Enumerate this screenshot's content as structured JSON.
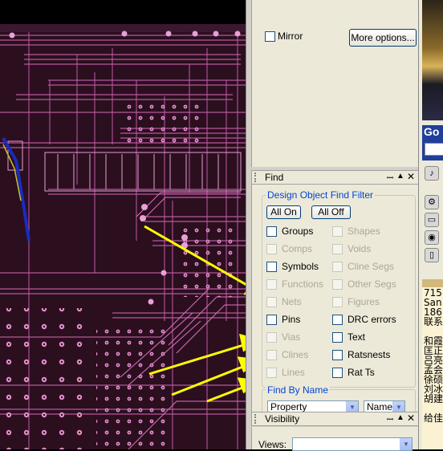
{
  "mirror": {
    "label": "Mirror",
    "checked": false
  },
  "more_options_label": "More options...",
  "find_panel": {
    "title": "Find",
    "filter_title": "Design Object Find Filter",
    "all_on": "All On",
    "all_off": "All Off",
    "left_items": [
      {
        "label": "Groups",
        "enabled": true
      },
      {
        "label": "Comps",
        "enabled": false
      },
      {
        "label": "Symbols",
        "enabled": true
      },
      {
        "label": "Functions",
        "enabled": false
      },
      {
        "label": "Nets",
        "enabled": false
      },
      {
        "label": "Pins",
        "enabled": true
      },
      {
        "label": "Vias",
        "enabled": false
      },
      {
        "label": "Clines",
        "enabled": false
      },
      {
        "label": "Lines",
        "enabled": false
      }
    ],
    "right_items": [
      {
        "label": "Shapes",
        "enabled": false
      },
      {
        "label": "Voids",
        "enabled": false
      },
      {
        "label": "Cline Segs",
        "enabled": false
      },
      {
        "label": "Other Segs",
        "enabled": false
      },
      {
        "label": "Figures",
        "enabled": false
      },
      {
        "label": "DRC errors",
        "enabled": true
      },
      {
        "label": "Text",
        "enabled": true
      },
      {
        "label": "Ratsnests",
        "enabled": true
      },
      {
        "label": "Rat Ts",
        "enabled": true
      }
    ],
    "find_by_name_title": "Find By Name",
    "property_value": "Property",
    "name_value": "Name"
  },
  "visibility_panel": {
    "title": "Visibility",
    "views_label": "Views:"
  },
  "side_strip": {
    "google_label": "Go",
    "chat_lines": [
      "715",
      "San",
      "186",
      "联系",
      "",
      "和霞",
      "匡正",
      "吕亮",
      "孟会",
      "徐硕",
      "刘冰",
      "胡建",
      "",
      "给佳"
    ]
  },
  "colors": {
    "pcb_background": "#2b0f1f",
    "trace": "#e070c0",
    "annotation_arrow": "#ffff00",
    "panel": "#ece9d8",
    "group_title": "#0046d5"
  }
}
